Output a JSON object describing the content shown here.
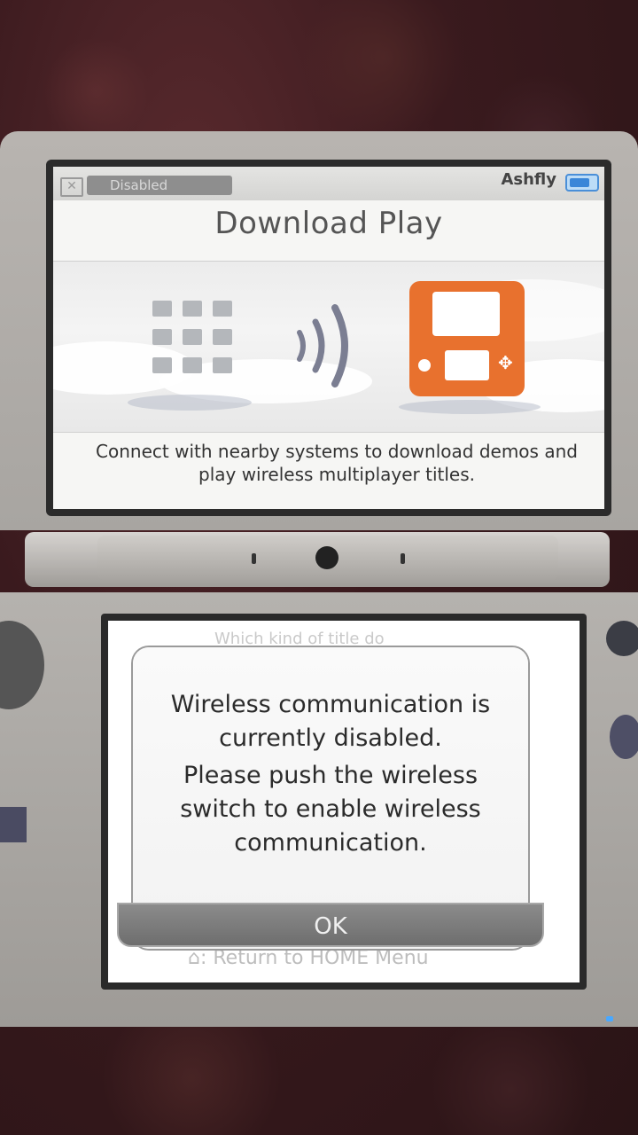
{
  "top_screen": {
    "status": {
      "wireless_badge": "Disabled",
      "username": "Ashfly"
    },
    "title": "Download Play",
    "description": "Connect with nearby systems to download demos and play wireless multiplayer titles."
  },
  "bottom_screen": {
    "background_prompt": "Which kind of title do",
    "background_footer": "⌂: Return to HOME Menu",
    "dialog": {
      "line1": "Wireless communication is currently disabled.",
      "line2": "Please push the wireless switch to enable wireless communication.",
      "ok_label": "OK"
    }
  },
  "colors": {
    "accent_orange": "#e8712e",
    "battery_blue": "#3a86d8"
  }
}
